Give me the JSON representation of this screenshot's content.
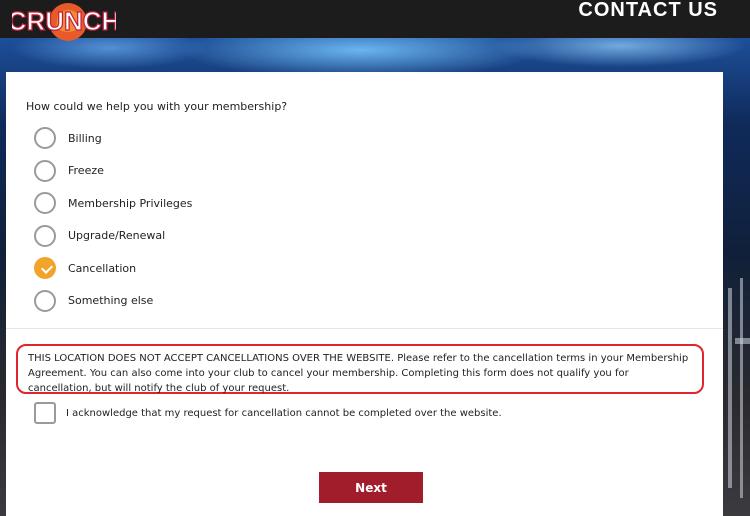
{
  "header": {
    "logo_text": "CRUNCH",
    "contact_label": "CONTACT US"
  },
  "form": {
    "question": "How could we help you with your membership?",
    "options": [
      {
        "label": "Billing",
        "selected": false
      },
      {
        "label": "Freeze",
        "selected": false
      },
      {
        "label": "Membership Privileges",
        "selected": false
      },
      {
        "label": "Upgrade/Renewal",
        "selected": false
      },
      {
        "label": "Cancellation",
        "selected": true
      },
      {
        "label": "Something else",
        "selected": false
      }
    ],
    "notice": "THIS LOCATION DOES NOT ACCEPT CANCELLATIONS OVER THE WEBSITE. Please refer to the cancellation terms in your Membership Agreement. You can also come into your club to cancel your membership. Completing this form does not qualify you for cancellation, but will notify the club of your request.",
    "acknowledge_label": "I acknowledge that my request for cancellation cannot be completed over the website.",
    "acknowledge_checked": false,
    "next_label": "Next"
  },
  "colors": {
    "accent_orange": "#f2a42a",
    "button_red": "#a11d2c",
    "notice_border": "#e0262a",
    "header_bg": "#1c1c1c"
  }
}
